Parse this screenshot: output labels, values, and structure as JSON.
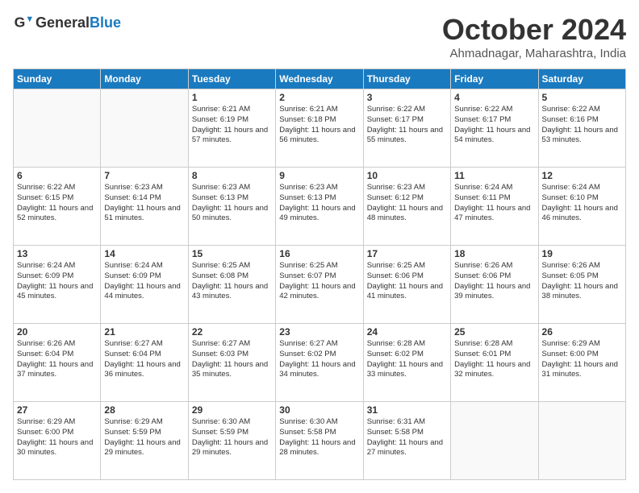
{
  "header": {
    "logo_general": "General",
    "logo_blue": "Blue",
    "title": "October 2024",
    "location": "Ahmadnagar, Maharashtra, India"
  },
  "days_of_week": [
    "Sunday",
    "Monday",
    "Tuesday",
    "Wednesday",
    "Thursday",
    "Friday",
    "Saturday"
  ],
  "weeks": [
    [
      {
        "day": "",
        "empty": true
      },
      {
        "day": "",
        "empty": true
      },
      {
        "day": "1",
        "sunrise": "6:21 AM",
        "sunset": "6:19 PM",
        "daylight": "11 hours and 57 minutes."
      },
      {
        "day": "2",
        "sunrise": "6:21 AM",
        "sunset": "6:18 PM",
        "daylight": "11 hours and 56 minutes."
      },
      {
        "day": "3",
        "sunrise": "6:22 AM",
        "sunset": "6:17 PM",
        "daylight": "11 hours and 55 minutes."
      },
      {
        "day": "4",
        "sunrise": "6:22 AM",
        "sunset": "6:17 PM",
        "daylight": "11 hours and 54 minutes."
      },
      {
        "day": "5",
        "sunrise": "6:22 AM",
        "sunset": "6:16 PM",
        "daylight": "11 hours and 53 minutes."
      }
    ],
    [
      {
        "day": "6",
        "sunrise": "6:22 AM",
        "sunset": "6:15 PM",
        "daylight": "11 hours and 52 minutes."
      },
      {
        "day": "7",
        "sunrise": "6:23 AM",
        "sunset": "6:14 PM",
        "daylight": "11 hours and 51 minutes."
      },
      {
        "day": "8",
        "sunrise": "6:23 AM",
        "sunset": "6:13 PM",
        "daylight": "11 hours and 50 minutes."
      },
      {
        "day": "9",
        "sunrise": "6:23 AM",
        "sunset": "6:13 PM",
        "daylight": "11 hours and 49 minutes."
      },
      {
        "day": "10",
        "sunrise": "6:23 AM",
        "sunset": "6:12 PM",
        "daylight": "11 hours and 48 minutes."
      },
      {
        "day": "11",
        "sunrise": "6:24 AM",
        "sunset": "6:11 PM",
        "daylight": "11 hours and 47 minutes."
      },
      {
        "day": "12",
        "sunrise": "6:24 AM",
        "sunset": "6:10 PM",
        "daylight": "11 hours and 46 minutes."
      }
    ],
    [
      {
        "day": "13",
        "sunrise": "6:24 AM",
        "sunset": "6:09 PM",
        "daylight": "11 hours and 45 minutes."
      },
      {
        "day": "14",
        "sunrise": "6:24 AM",
        "sunset": "6:09 PM",
        "daylight": "11 hours and 44 minutes."
      },
      {
        "day": "15",
        "sunrise": "6:25 AM",
        "sunset": "6:08 PM",
        "daylight": "11 hours and 43 minutes."
      },
      {
        "day": "16",
        "sunrise": "6:25 AM",
        "sunset": "6:07 PM",
        "daylight": "11 hours and 42 minutes."
      },
      {
        "day": "17",
        "sunrise": "6:25 AM",
        "sunset": "6:06 PM",
        "daylight": "11 hours and 41 minutes."
      },
      {
        "day": "18",
        "sunrise": "6:26 AM",
        "sunset": "6:06 PM",
        "daylight": "11 hours and 39 minutes."
      },
      {
        "day": "19",
        "sunrise": "6:26 AM",
        "sunset": "6:05 PM",
        "daylight": "11 hours and 38 minutes."
      }
    ],
    [
      {
        "day": "20",
        "sunrise": "6:26 AM",
        "sunset": "6:04 PM",
        "daylight": "11 hours and 37 minutes."
      },
      {
        "day": "21",
        "sunrise": "6:27 AM",
        "sunset": "6:04 PM",
        "daylight": "11 hours and 36 minutes."
      },
      {
        "day": "22",
        "sunrise": "6:27 AM",
        "sunset": "6:03 PM",
        "daylight": "11 hours and 35 minutes."
      },
      {
        "day": "23",
        "sunrise": "6:27 AM",
        "sunset": "6:02 PM",
        "daylight": "11 hours and 34 minutes."
      },
      {
        "day": "24",
        "sunrise": "6:28 AM",
        "sunset": "6:02 PM",
        "daylight": "11 hours and 33 minutes."
      },
      {
        "day": "25",
        "sunrise": "6:28 AM",
        "sunset": "6:01 PM",
        "daylight": "11 hours and 32 minutes."
      },
      {
        "day": "26",
        "sunrise": "6:29 AM",
        "sunset": "6:00 PM",
        "daylight": "11 hours and 31 minutes."
      }
    ],
    [
      {
        "day": "27",
        "sunrise": "6:29 AM",
        "sunset": "6:00 PM",
        "daylight": "11 hours and 30 minutes."
      },
      {
        "day": "28",
        "sunrise": "6:29 AM",
        "sunset": "5:59 PM",
        "daylight": "11 hours and 29 minutes."
      },
      {
        "day": "29",
        "sunrise": "6:30 AM",
        "sunset": "5:59 PM",
        "daylight": "11 hours and 29 minutes."
      },
      {
        "day": "30",
        "sunrise": "6:30 AM",
        "sunset": "5:58 PM",
        "daylight": "11 hours and 28 minutes."
      },
      {
        "day": "31",
        "sunrise": "6:31 AM",
        "sunset": "5:58 PM",
        "daylight": "11 hours and 27 minutes."
      },
      {
        "day": "",
        "empty": true
      },
      {
        "day": "",
        "empty": true
      }
    ]
  ],
  "labels": {
    "sunrise": "Sunrise:",
    "sunset": "Sunset:",
    "daylight": "Daylight:"
  }
}
